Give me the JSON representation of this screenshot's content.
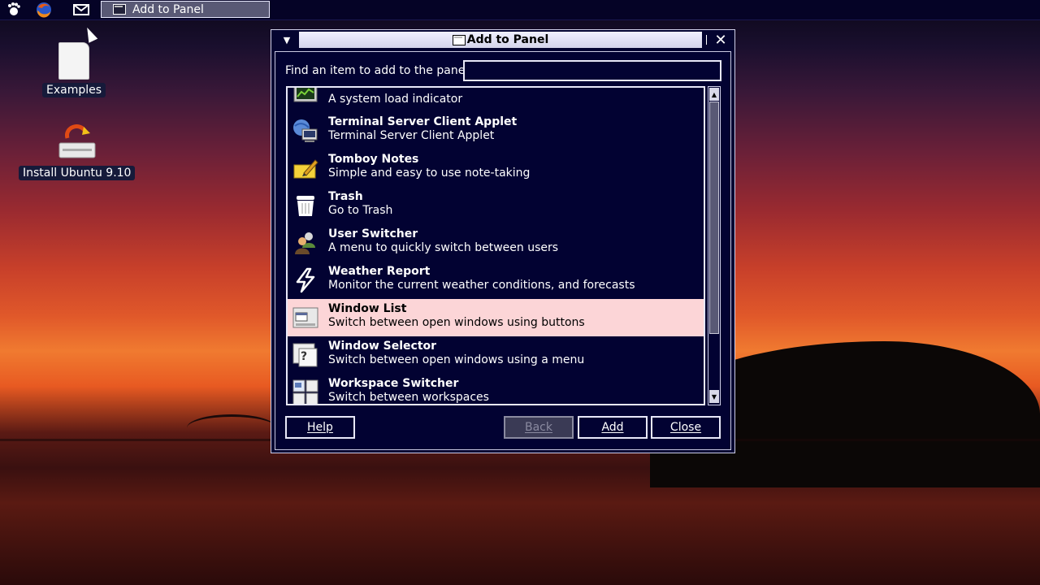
{
  "panel": {
    "taskbar_button": "Add to Panel",
    "icons": [
      "gnome-foot-icon",
      "firefox-icon",
      "mail-icon"
    ]
  },
  "desktop": {
    "examples_label": "Examples",
    "install_label": "Install Ubuntu 9.10"
  },
  "dialog": {
    "title": "Add to Panel",
    "find_label": "Find an item to add to the panel:",
    "find_value": "",
    "items": [
      {
        "title": "",
        "desc": "A system load indicator",
        "icon": "system-monitor-icon"
      },
      {
        "title": "Terminal Server Client Applet",
        "desc": "Terminal Server Client Applet",
        "icon": "terminal-server-icon"
      },
      {
        "title": "Tomboy Notes",
        "desc": "Simple and easy to use note-taking",
        "icon": "tomboy-notes-icon"
      },
      {
        "title": "Trash",
        "desc": "Go to Trash",
        "icon": "trash-icon"
      },
      {
        "title": "User Switcher",
        "desc": "A menu to quickly switch between users",
        "icon": "user-switcher-icon"
      },
      {
        "title": "Weather Report",
        "desc": "Monitor the current weather conditions, and forecasts",
        "icon": "weather-icon"
      },
      {
        "title": "Window List",
        "desc": "Switch between open windows using buttons",
        "icon": "window-list-icon",
        "selected": true
      },
      {
        "title": "Window Selector",
        "desc": "Switch between open windows using a menu",
        "icon": "window-selector-icon"
      },
      {
        "title": "Workspace Switcher",
        "desc": "Switch between workspaces",
        "icon": "workspace-switcher-icon"
      }
    ],
    "buttons": {
      "help": "Help",
      "back": "Back",
      "add": "Add",
      "close": "Close"
    }
  }
}
